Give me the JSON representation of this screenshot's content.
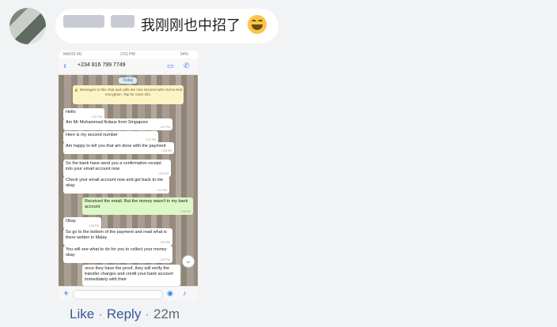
{
  "comment": {
    "text": "我刚刚也中招了",
    "emoji": "laughing-tears"
  },
  "screenshot": {
    "status": {
      "carrier": "MAXIS 4G",
      "time": "2:01 PM",
      "battery": "54%"
    },
    "contact": "+234 816 799 7749",
    "date_label": "Today",
    "encryption_notice": "🔒 Messages to this chat and calls are now secured with end-to-end encryption. Tap for more info.",
    "messages": [
      {
        "text": "Hello",
        "time": "1:52 PM",
        "sent": false
      },
      {
        "text": "Am Mr Muhammad firdaus from Singapore",
        "time": "1:52 PM",
        "sent": false
      },
      {
        "text": "Here is my second number",
        "time": "1:52 PM",
        "sent": false
      },
      {
        "text": "Am happy to tell you that am done with the payment",
        "time": "1:53 PM",
        "sent": false
      },
      {
        "text": "So the bank have send you a confirmation receipt into your email account now",
        "time": "1:53 PM",
        "sent": false
      },
      {
        "text": "Check your email account now and get back to me okay",
        "time": "1:54 PM",
        "sent": false
      },
      {
        "text": "Received the email. But the money wasn't in my bank account",
        "time": "1:58 PM",
        "sent": true
      },
      {
        "text": "Okay",
        "time": "1:58 PM",
        "sent": false
      },
      {
        "text": "So go to the bottom of the payment and read what is there written in Malay",
        "time": "1:59 PM",
        "sent": false
      },
      {
        "text": "You will see what to do for you to collect your money okay",
        "time": "1:59 PM",
        "sent": false
      },
      {
        "text": "once they have the proof, they will verify the transfer charges and credit your bank account immediately with their",
        "time": "",
        "sent": false
      }
    ]
  },
  "actions": {
    "like": "Like",
    "separator": "·",
    "reply": "Reply",
    "time": "22m"
  }
}
